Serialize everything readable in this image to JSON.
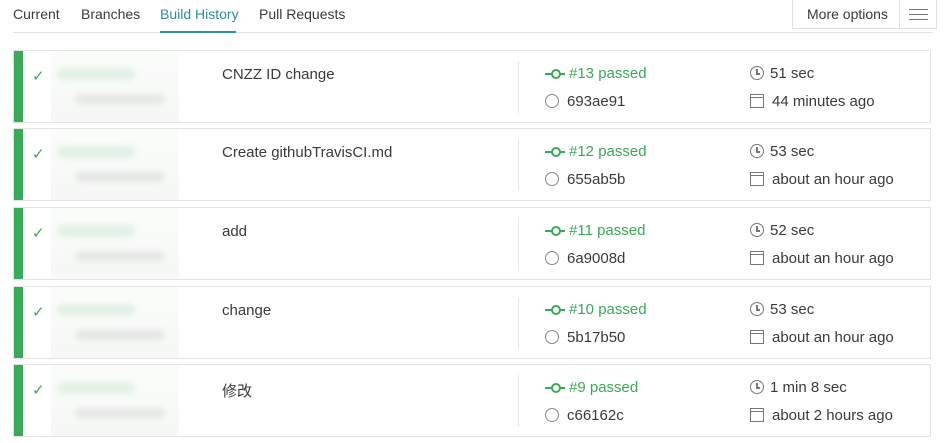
{
  "tabs": {
    "current": "Current",
    "branches": "Branches",
    "build_history": "Build History",
    "pull_requests": "Pull Requests",
    "more_options": "More options"
  },
  "colors": {
    "accent": "#2e8ea5",
    "passed": "#39aa56"
  },
  "builds": [
    {
      "message": "CNZZ ID change",
      "status": "#13 passed",
      "sha": "693ae91",
      "duration": "51 sec",
      "finished": "44 minutes ago"
    },
    {
      "message": "Create githubTravisCI.md",
      "status": "#12 passed",
      "sha": "655ab5b",
      "duration": "53 sec",
      "finished": "about an hour ago"
    },
    {
      "message": "add",
      "status": "#11 passed",
      "sha": "6a9008d",
      "duration": "52 sec",
      "finished": "about an hour ago"
    },
    {
      "message": "change",
      "status": "#10 passed",
      "sha": "5b17b50",
      "duration": "53 sec",
      "finished": "about an hour ago"
    },
    {
      "message": "修改",
      "status": "#9 passed",
      "sha": "c66162c",
      "duration": "1 min 8 sec",
      "finished": "about 2 hours ago"
    }
  ]
}
